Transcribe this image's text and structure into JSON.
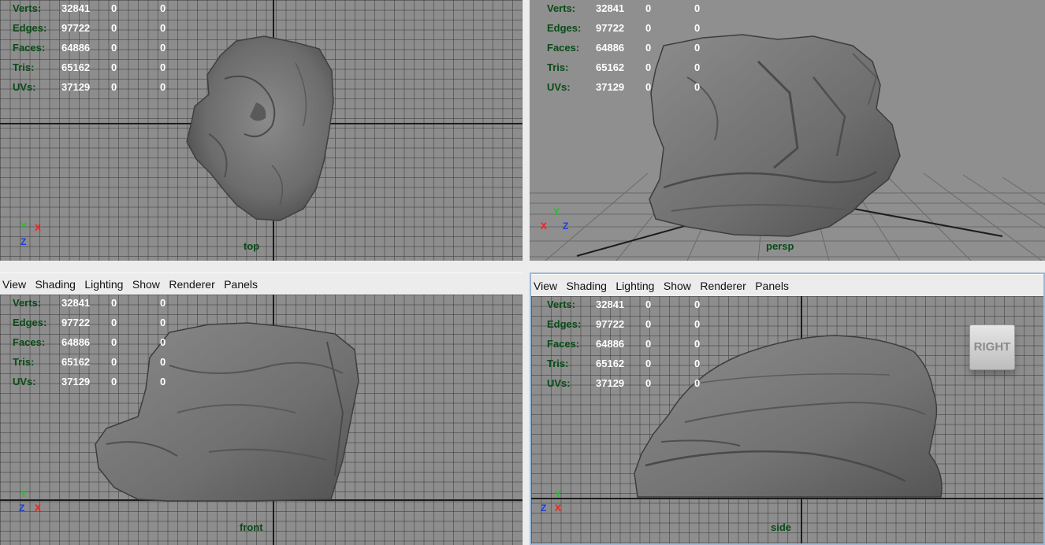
{
  "menu": [
    "View",
    "Shading",
    "Lighting",
    "Show",
    "Renderer",
    "Panels"
  ],
  "hud_rows": [
    {
      "label": "Verts:",
      "v1": "32841",
      "v2": "0",
      "v3": "0"
    },
    {
      "label": "Edges:",
      "v1": "97722",
      "v2": "0",
      "v3": "0"
    },
    {
      "label": "Faces:",
      "v1": "64886",
      "v2": "0",
      "v3": "0"
    },
    {
      "label": "Tris:",
      "v1": "65162",
      "v2": "0",
      "v3": "0"
    },
    {
      "label": "UVs:",
      "v1": "37129",
      "v2": "0",
      "v3": "0"
    }
  ],
  "panels": {
    "top": {
      "camera": "top",
      "gizmo": {
        "y": "Y",
        "x": "X",
        "z": "Z"
      }
    },
    "persp": {
      "camera": "persp",
      "gizmo": {
        "x": "X",
        "y": "Y",
        "z": "Z"
      }
    },
    "front": {
      "camera": "front",
      "gizmo": {
        "y": "Y",
        "z": "Z",
        "x": "X"
      }
    },
    "side": {
      "camera": "side",
      "gizmo": {
        "y": "Y",
        "z": "Z",
        "x": "X"
      },
      "viewcube": "RIGHT"
    }
  },
  "colors": {
    "viewport_bg": "#8d8d8d",
    "hud_label": "#0a4b18",
    "hud_value": "#ffffff",
    "active_border": "#9db8d4"
  }
}
